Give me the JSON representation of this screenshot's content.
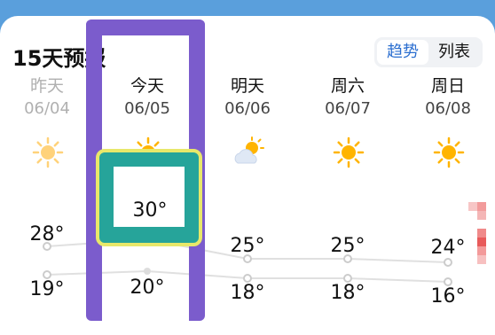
{
  "header": {
    "title": "15天预报"
  },
  "view_toggle": {
    "trend": "趋势",
    "list": "列表"
  },
  "days": [
    {
      "name": "昨天",
      "date": "06/04",
      "high": "28°",
      "low": "19°",
      "icon": "sun-icon",
      "past": true
    },
    {
      "name": "今天",
      "date": "06/05",
      "high": "30°",
      "low": "20°",
      "icon": "sun-icon",
      "past": false
    },
    {
      "name": "明天",
      "date": "06/06",
      "high": "25°",
      "low": "18°",
      "icon": "partly-cloudy-icon",
      "past": false
    },
    {
      "name": "周六",
      "date": "06/07",
      "high": "25°",
      "low": "18°",
      "icon": "sun-icon",
      "past": false
    },
    {
      "name": "周日",
      "date": "06/08",
      "high": "24°",
      "low": "16°",
      "icon": "sun-icon",
      "past": false
    }
  ],
  "colors": {
    "background": "#5a9fdc",
    "accent": "#2c6fd0",
    "selection_frame": "#7b5ccc",
    "highlight": "#26a49a"
  }
}
